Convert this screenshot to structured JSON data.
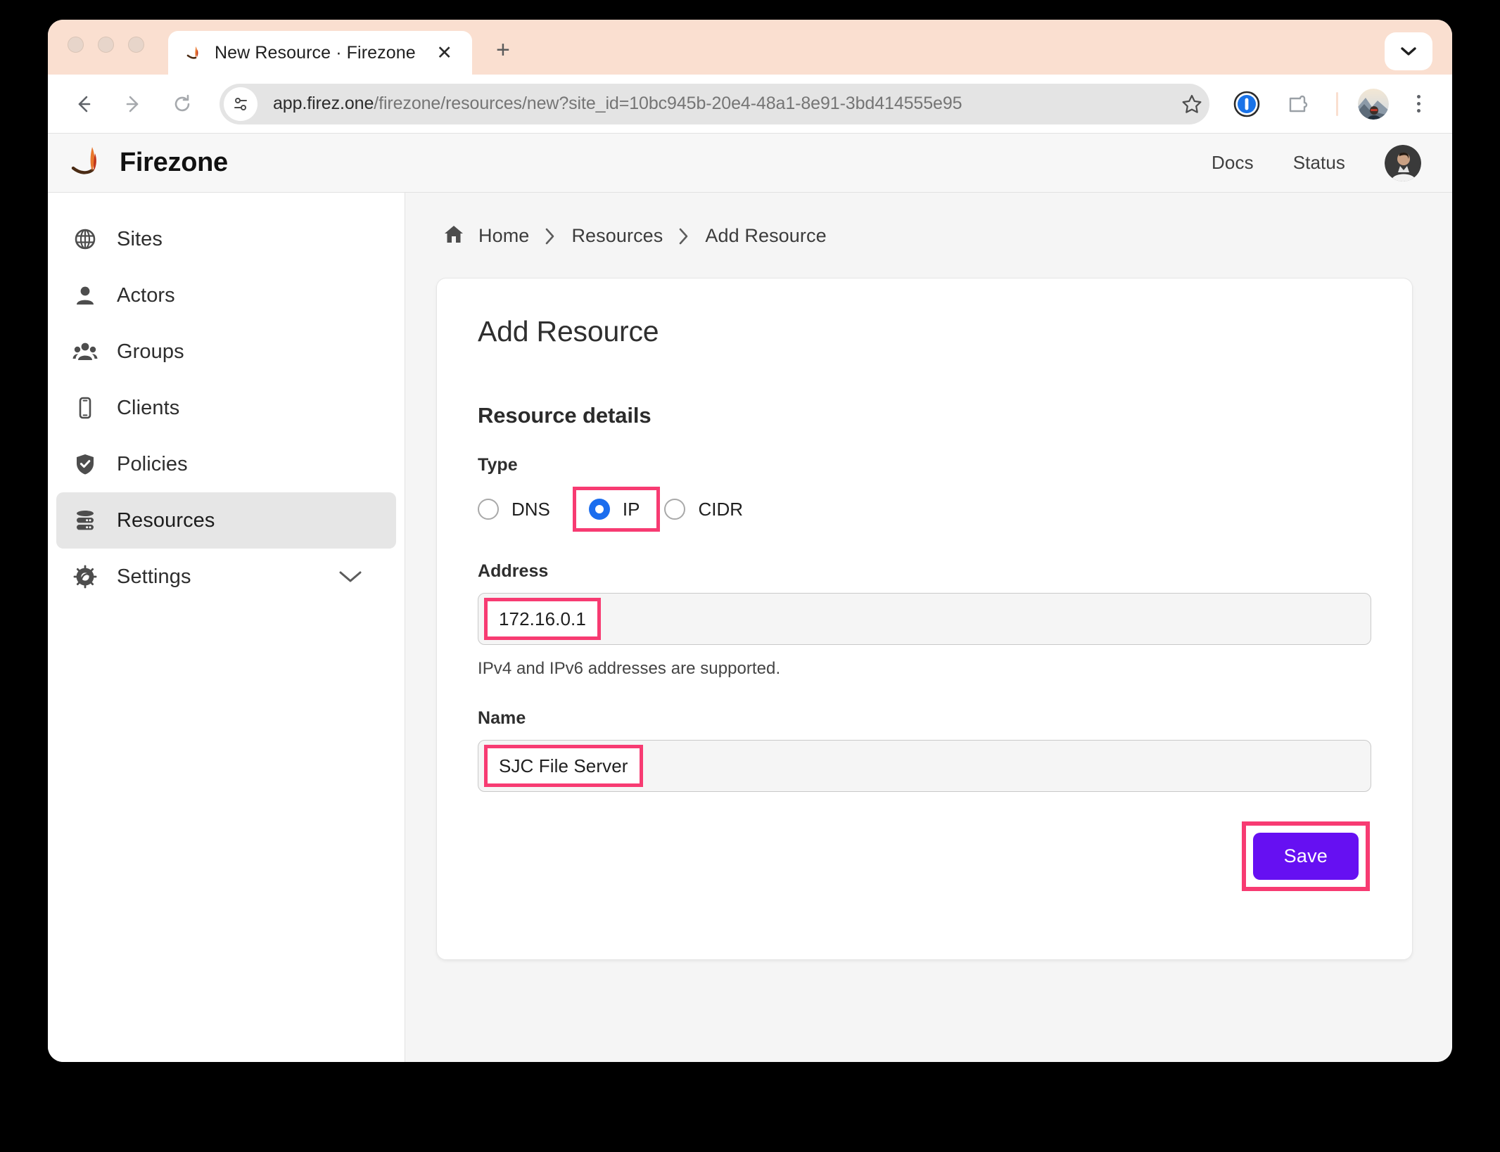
{
  "browser": {
    "tab": {
      "title": "New Resource · Firezone",
      "favicon": "firezone-flame-icon",
      "close_label": "✕"
    },
    "new_tab_label": "+",
    "toolbar": {
      "back_icon": "back-arrow-icon",
      "forward_icon": "forward-arrow-icon",
      "reload_icon": "reload-icon",
      "site_info_icon": "site-settings-icon",
      "url_prefix": "app.firez.one",
      "url_path": "/firezone/resources/new?site_id=10bc945b-20e4-48a1-8e91-3bd414555e95",
      "url_full": "app.firez.one/firezone/resources/new?site_id=10bc945b-20e4-48a1-8e91-3bd414555e95",
      "bookmark_icon": "star-icon",
      "password_manager_icon": "onepassword-icon",
      "extensions_icon": "extensions-puzzle-icon",
      "profile_icon": "profile-avatar",
      "menu_icon": "three-dots-menu-icon"
    },
    "tab_list_icon": "chevron-down-icon"
  },
  "app": {
    "brand": {
      "name": "Firezone",
      "logo_icon": "firezone-flame-logo"
    },
    "header_links": [
      {
        "label": "Docs"
      },
      {
        "label": "Status"
      }
    ],
    "header_avatar": "user-avatar"
  },
  "sidebar": {
    "items": [
      {
        "label": "Sites",
        "icon": "globe-icon",
        "active": false
      },
      {
        "label": "Actors",
        "icon": "person-icon",
        "active": false
      },
      {
        "label": "Groups",
        "icon": "people-icon",
        "active": false
      },
      {
        "label": "Clients",
        "icon": "phone-icon",
        "active": false
      },
      {
        "label": "Policies",
        "icon": "shield-check-icon",
        "active": false
      },
      {
        "label": "Resources",
        "icon": "server-icon",
        "active": true
      },
      {
        "label": "Settings",
        "icon": "gear-icon",
        "active": false,
        "expandable": true
      }
    ]
  },
  "breadcrumb": {
    "home_icon": "home-icon",
    "items": [
      {
        "label": "Home"
      },
      {
        "label": "Resources"
      },
      {
        "label": "Add Resource"
      }
    ],
    "separator": "chevron-right-icon"
  },
  "main": {
    "card_title": "Add Resource",
    "section_title": "Resource details",
    "type_field": {
      "label": "Type",
      "options": [
        {
          "label": "DNS",
          "selected": false,
          "highlighted": false
        },
        {
          "label": "IP",
          "selected": true,
          "highlighted": true
        },
        {
          "label": "CIDR",
          "selected": false,
          "highlighted": false
        }
      ]
    },
    "address_field": {
      "label": "Address",
      "value": "172.16.0.1",
      "helper": "IPv4 and IPv6 addresses are supported.",
      "highlighted": true
    },
    "name_field": {
      "label": "Name",
      "value": "SJC File Server",
      "highlighted": true
    },
    "save_label": "Save"
  },
  "colors": {
    "annotation": "#f73b72",
    "save_button": "#6610f2",
    "radio_selected": "#1b6dee",
    "tab_strip": "#fadfd0",
    "page_bg": "#f5f5f5",
    "sidebar_active": "#e6e6e6"
  }
}
